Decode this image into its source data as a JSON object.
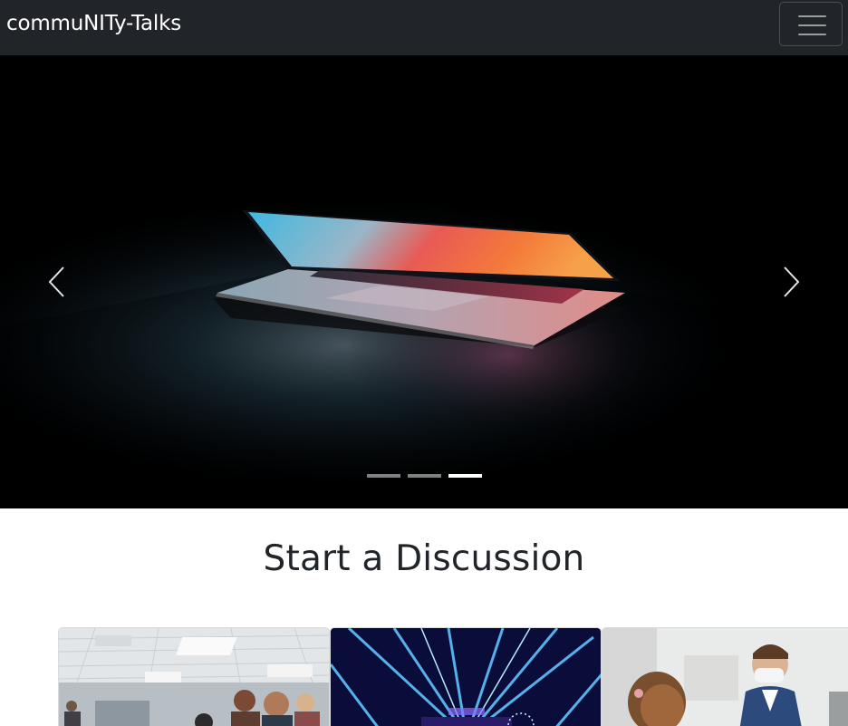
{
  "navbar": {
    "brand": "commuNITy-Talks",
    "toggler_icon": "hamburger-icon"
  },
  "carousel": {
    "slides": [
      {
        "image": "laptop-glow-image"
      }
    ],
    "active_index": 2,
    "indicator_count": 3,
    "prev_icon": "chevron-left-icon",
    "next_icon": "chevron-right-icon"
  },
  "section": {
    "title": "Start a Discussion"
  },
  "cards": [
    {
      "image": "classroom-audience-image"
    },
    {
      "image": "concert-light-show-image"
    },
    {
      "image": "masked-business-meeting-image"
    }
  ]
}
